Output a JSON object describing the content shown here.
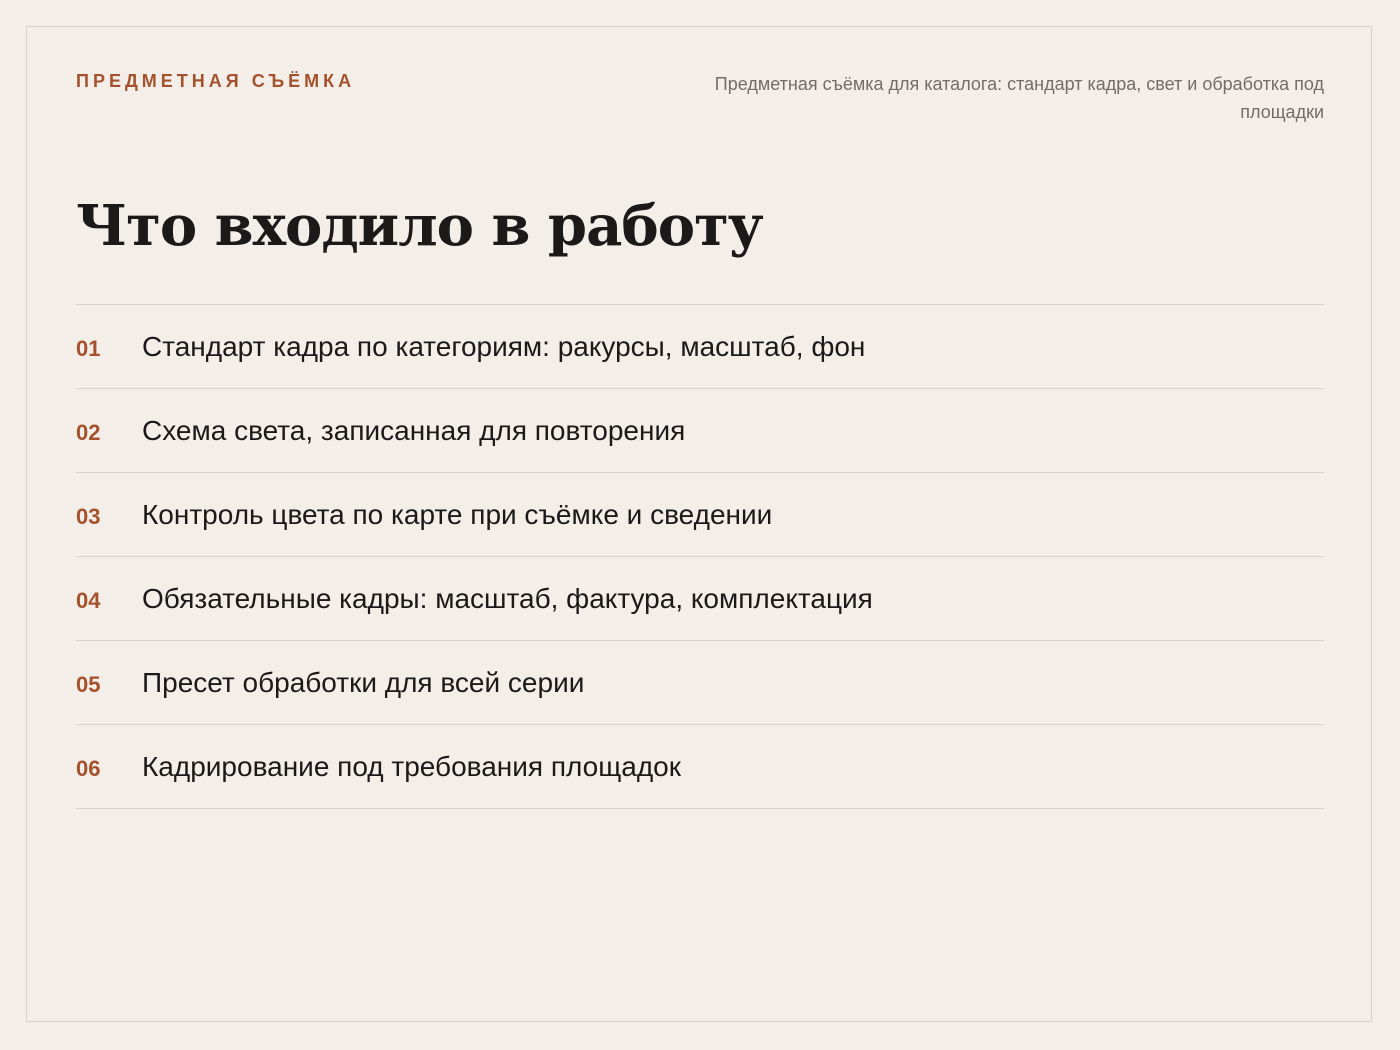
{
  "header": {
    "eyebrow": "ПРЕДМЕТНАЯ СЪЁМКА",
    "subtitle": "Предметная съёмка для каталога: стандарт кадра, свет и обработка под площадки"
  },
  "main": {
    "title": "Что входило в работу",
    "items": [
      {
        "number": "01",
        "text": "Стандарт кадра по категориям: ракурсы, масштаб, фон"
      },
      {
        "number": "02",
        "text": "Схема света, записанная для повторения"
      },
      {
        "number": "03",
        "text": "Контроль цвета по карте при съёмке и сведении"
      },
      {
        "number": "04",
        "text": "Обязательные кадры: масштаб, фактура, комплектация"
      },
      {
        "number": "05",
        "text": "Пресет обработки для всей серии"
      },
      {
        "number": "06",
        "text": "Кадрирование под требования площадок"
      }
    ]
  },
  "colors": {
    "background": "#f3eee8",
    "accent": "#a4522e",
    "text": "#1b1a19",
    "muted": "#736d67",
    "divider": "#d9d2ca"
  }
}
